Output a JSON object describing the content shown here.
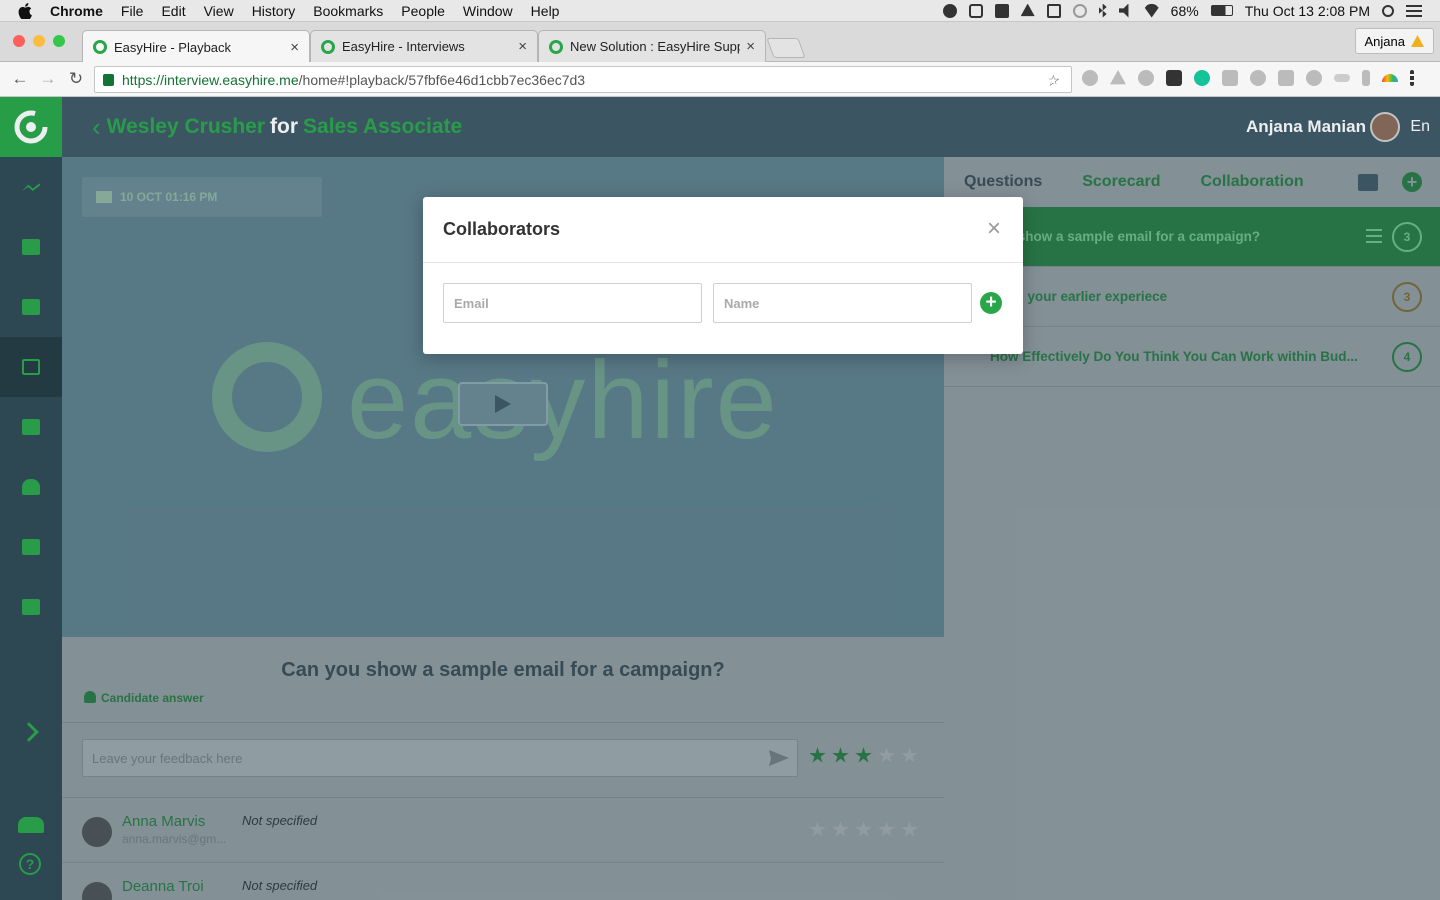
{
  "macmenu": {
    "app": "Chrome",
    "items": [
      "File",
      "Edit",
      "View",
      "History",
      "Bookmarks",
      "People",
      "Window",
      "Help"
    ],
    "battery": "68%",
    "clock": "Thu Oct 13  2:08 PM"
  },
  "browser": {
    "tabs": [
      {
        "label": "EasyHire - Playback",
        "close": "×"
      },
      {
        "label": "EasyHire - Interviews",
        "close": "×"
      },
      {
        "label": "New Solution : EasyHire Supp",
        "close": "×"
      }
    ],
    "profile": "Anjana",
    "url_secure": "https://interview.easyhire.me",
    "url_rest": "/home#!playback/57fbf6e46d1cbb7ec36ec7d3"
  },
  "header": {
    "candidate": "Wesley Crusher",
    "for": "for",
    "role": "Sales Associate",
    "user": "Anjana Manian",
    "lang": "En"
  },
  "video": {
    "date": "10 OCT 01:16 PM",
    "watermark": "easyhire"
  },
  "answer": {
    "question": "Can you show a sample email for a campaign?",
    "candidate_answer": "Candidate answer",
    "feedback_placeholder": "Leave your feedback here",
    "rating": 3,
    "collaborators": [
      {
        "name": "Anna Marvis",
        "email": "anna.marvis@gm...",
        "status": "Not specified"
      },
      {
        "name": "Deanna Troi",
        "email": "",
        "status": "Not specified"
      }
    ]
  },
  "rightpanel": {
    "tabs": [
      "Questions",
      "Scorecard",
      "Collaboration"
    ],
    "questions": [
      {
        "text": "you show a sample email for a campaign?",
        "score": "3"
      },
      {
        "text": "t was your earlier experiece",
        "score": "3"
      },
      {
        "text": "How Effectively Do You Think You Can Work within Bud...",
        "score": "4"
      }
    ]
  },
  "modal": {
    "title": "Collaborators",
    "close": "×",
    "email_placeholder": "Email",
    "name_placeholder": "Name",
    "add": "+"
  },
  "colors": {
    "accent": "#2aa64a",
    "sidebar": "#2f4b56"
  }
}
